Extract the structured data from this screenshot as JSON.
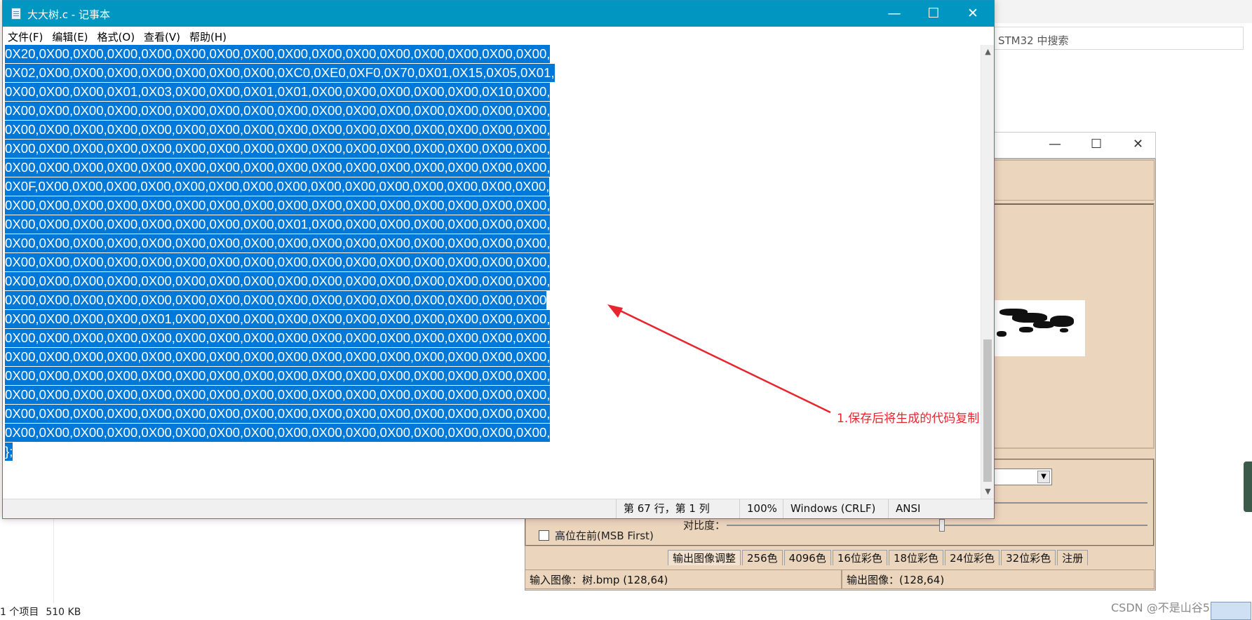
{
  "explorer": {
    "search_placeholder": "STM32 中搜索",
    "status_items": "1 个项目",
    "status_size": "510 KB"
  },
  "tool_window": {
    "contrast_label": "对比度：",
    "msb_first_label": "高位在前(MSB First)",
    "tabs": [
      "输出图像调整",
      "256色",
      "4096色",
      "16位彩色",
      "18位彩色",
      "24位彩色",
      "32位彩色",
      "注册"
    ],
    "input_image": "输入图像：树.bmp (128,64)",
    "output_image": "输出图像：(128,64)",
    "background_color": "#ebd5bd"
  },
  "notepad": {
    "title": "大大树.c - 记事本",
    "menu": [
      "文件(F)",
      "编辑(E)",
      "格式(O)",
      "查看(V)",
      "帮助(H)"
    ],
    "lines": [
      "0X20,0X00,0X00,0X00,0X00,0X00,0X00,0X00,0X00,0X00,0X00,0X00,0X00,0X00,0X00,0X00,",
      "0X02,0X00,0X00,0X00,0X00,0X00,0X00,0X00,0XC0,0XE0,0XF0,0X70,0X01,0X15,0X05,0X01,",
      "0X00,0X00,0X00,0X01,0X03,0X00,0X00,0X01,0X01,0X00,0X00,0X00,0X00,0X00,0X10,0X00,",
      "0X00,0X00,0X00,0X00,0X00,0X00,0X00,0X00,0X00,0X00,0X00,0X00,0X00,0X00,0X00,0X00,",
      "0X00,0X00,0X00,0X00,0X00,0X00,0X00,0X00,0X00,0X00,0X00,0X00,0X00,0X00,0X00,0X00,",
      "0X00,0X00,0X00,0X00,0X00,0X00,0X00,0X00,0X00,0X00,0X00,0X00,0X00,0X00,0X00,0X00,",
      "0X00,0X00,0X00,0X00,0X00,0X00,0X00,0X00,0X00,0X00,0X00,0X00,0X00,0X00,0X00,0X00,",
      "0X0F,0X00,0X00,0X00,0X00,0X00,0X00,0X00,0X00,0X00,0X00,0X00,0X00,0X00,0X00,0X00,",
      "0X00,0X00,0X00,0X00,0X00,0X00,0X00,0X00,0X00,0X00,0X00,0X00,0X00,0X00,0X00,0X00,",
      "0X00,0X00,0X00,0X00,0X00,0X00,0X00,0X00,0X01,0X00,0X00,0X00,0X00,0X00,0X00,0X00,",
      "0X00,0X00,0X00,0X00,0X00,0X00,0X00,0X00,0X00,0X00,0X00,0X00,0X00,0X00,0X00,0X00,",
      "0X00,0X00,0X00,0X00,0X00,0X00,0X00,0X00,0X00,0X00,0X00,0X00,0X00,0X00,0X00,0X00,",
      "0X00,0X00,0X00,0X00,0X00,0X00,0X00,0X00,0X00,0X00,0X00,0X00,0X00,0X00,0X00,0X00,",
      "0X00,0X00,0X00,0X00,0X00,0X00,0X00,0X00,0X00,0X00,0X00,0X00,0X00,0X00,0X00,0X00",
      "0X00,0X00,0X00,0X00,0X01,0X00,0X00,0X00,0X00,0X00,0X00,0X00,0X00,0X00,0X00,0X00,",
      "0X00,0X00,0X00,0X00,0X00,0X00,0X00,0X00,0X00,0X00,0X00,0X00,0X00,0X00,0X00,0X00,",
      "0X00,0X00,0X00,0X00,0X00,0X00,0X00,0X00,0X00,0X00,0X00,0X00,0X00,0X00,0X00,0X00,",
      "0X00,0X00,0X00,0X00,0X00,0X00,0X00,0X00,0X00,0X00,0X00,0X00,0X00,0X00,0X00,0X00,",
      "0X00,0X00,0X00,0X00,0X00,0X00,0X00,0X00,0X00,0X00,0X00,0X00,0X00,0X00,0X00,0X00,",
      "0X00,0X00,0X00,0X00,0X00,0X00,0X00,0X00,0X00,0X00,0X00,0X00,0X00,0X00,0X00,0X00,",
      "0X00,0X00,0X00,0X00,0X00,0X00,0X00,0X00,0X00,0X00,0X00,0X00,0X00,0X00,0X00,0X00,",
      "};"
    ],
    "status": {
      "position": "第 67 行，第 1 列",
      "zoom": "100%",
      "line_ending": "Windows (CRLF)",
      "encoding": "ANSI"
    },
    "selection_color": "#0078d7",
    "title_color": "#0096c2"
  },
  "annotation": {
    "text": "1.保存后将生成的代码复制",
    "color": "#e8252f"
  },
  "watermark": "CSDN @不是山谷517"
}
